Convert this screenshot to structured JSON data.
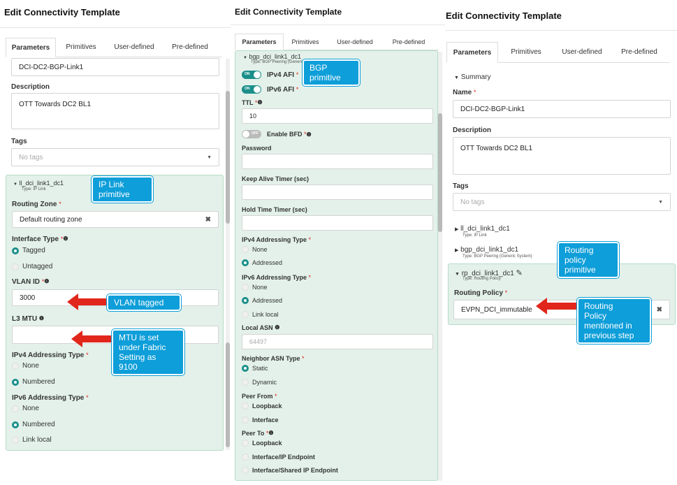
{
  "p1": {
    "title": "Edit Connectivity Template",
    "tabs": [
      "Parameters",
      "Primitives",
      "User-defined",
      "Pre-defined"
    ],
    "name_value": "DCI-DC2-BGP-Link1",
    "description_label": "Description",
    "description_value": "OTT Towards DC2 BL1",
    "tags_label": "Tags",
    "tags_placeholder": "No tags",
    "block_name": "ll_dci_link1_dc1",
    "block_type": "Type: IP Link",
    "routing_zone_label": "Routing Zone",
    "routing_zone_value": "Default routing zone",
    "interface_type_label": "Interface Type",
    "tagged": "Tagged",
    "untagged": "Untagged",
    "vlan_label": "VLAN ID",
    "vlan_value": "3000",
    "l3mtu_label": "L3 MTU",
    "ipv4_label": "IPv4 Addressing Type",
    "none": "None",
    "numbered": "Numbered",
    "ipv6_label": "IPv6 Addressing Type",
    "link_local": "Link local",
    "callout_iplink": [
      "IP Link",
      "primitive"
    ],
    "callout_vlan": [
      "VLAN tagged"
    ],
    "callout_mtu": [
      "MTU is set",
      "under Fabric",
      "Setting as",
      "9100"
    ]
  },
  "p2": {
    "title": "Edit Connectivity Template",
    "tabs": [
      "Parameters",
      "Primitives",
      "User-defined",
      "Pre-defined"
    ],
    "block_name": "bgp_dci_link1_dc1",
    "block_type": "Type: BGP Peering (Generic",
    "on": "ON",
    "off": "OFF",
    "ipv4_afi": "IPv4 AFI",
    "ipv6_afi": "IPv6 AFI",
    "ttl_label": "TTL",
    "ttl_value": "10",
    "bfd": "Enable BFD",
    "password_label": "Password",
    "keepalive_label": "Keep Alive Timer (sec)",
    "holdtime_label": "Hold Time Timer (sec)",
    "ipv4_label": "IPv4 Addressing Type",
    "none": "None",
    "addressed": "Addressed",
    "ipv6_label": "IPv6 Addressing Type",
    "link_local": "Link local",
    "local_asn_label": "Local ASN",
    "local_asn_placeholder": "64497",
    "neighbor_asn_label": "Neighbor ASN Type",
    "static": "Static",
    "dynamic": "Dynamic",
    "peer_from_label": "Peer From",
    "loopback": "Loopback",
    "interface": "Interface",
    "peer_to_label": "Peer To",
    "interface_ip": "Interface/IP Endpoint",
    "interface_shared": "Interface/Shared IP Endpoint",
    "callout_bgp": [
      "BGP",
      "primitive"
    ]
  },
  "p3": {
    "title": "Edit Connectivity Template",
    "tabs": [
      "Parameters",
      "Primitives",
      "User-defined",
      "Pre-defined"
    ],
    "summary": "Summary",
    "name_label": "Name",
    "name_value": "DCI-DC2-BGP-Link1",
    "description_label": "Description",
    "description_value": "OTT Towards DC2 BL1",
    "tags_label": "Tags",
    "tags_placeholder": "No tags",
    "node1_name": "ll_dci_link1_dc1",
    "node1_type": "Type: IP Link",
    "node2_name": "bgp_dci_link1_dc1",
    "node2_type": "Type: BGP Peering (Generic System)",
    "node3_name": "rp_dci_link1_dc1",
    "node3_type": "Type: Routing Policy",
    "routing_policy_label": "Routing Policy",
    "routing_policy_value": "EVPN_DCI_immutable",
    "callout_rp": [
      "Routing",
      "policy",
      "primitive"
    ],
    "callout_mentioned": [
      "Routing",
      "Policy",
      "mentioned in",
      "previous step"
    ]
  },
  "colors": {
    "accent": "#1b8f8a",
    "callout": "#0e9ed9",
    "arrow": "#e1261c",
    "panel": "#e3f1ea"
  }
}
